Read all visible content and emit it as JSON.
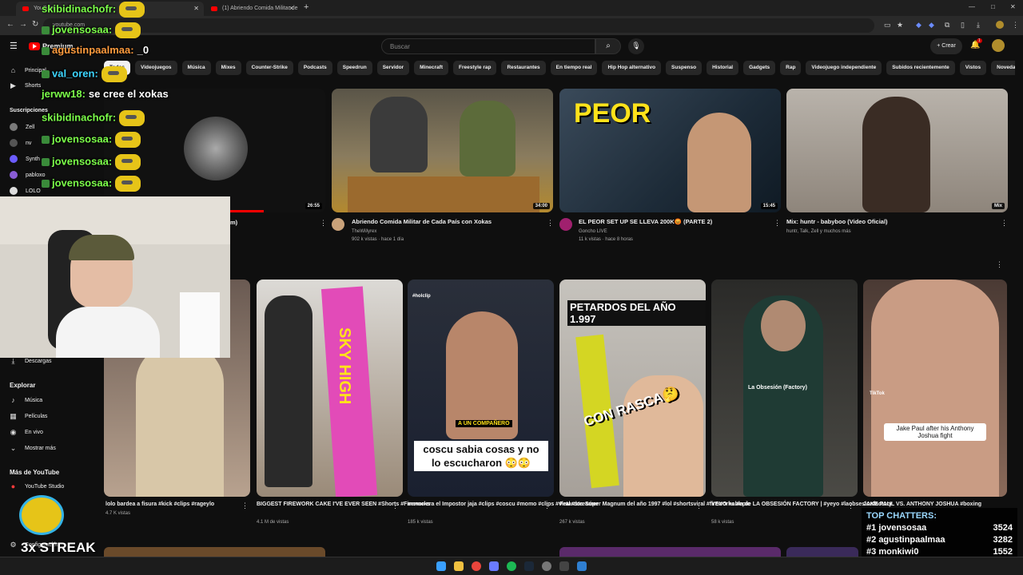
{
  "browser": {
    "tabs": [
      {
        "label": "YouTube"
      },
      {
        "label": "(1) Abriendo Comida Militar de"
      }
    ],
    "new_tab": "+",
    "url": "youtube.com",
    "window_controls": [
      "—",
      "□",
      "✕"
    ]
  },
  "header": {
    "logo": "Premium",
    "search_placeholder": "Buscar",
    "create_label": "Crear",
    "notif_count": "1"
  },
  "chips": [
    "Todos",
    "Videojuegos",
    "Música",
    "Mixes",
    "Counter-Strike",
    "Podcasts",
    "Speedrun",
    "Servidor",
    "Minecraft",
    "Freestyle rap",
    "Restaurantes",
    "En tiempo real",
    "Hip Hop alternativo",
    "Suspenso",
    "Historial",
    "Gadgets",
    "Rap",
    "Videojuego independiente",
    "Subidos recientemente",
    "Vistos",
    "Novedad pa"
  ],
  "sidebar": {
    "main": [
      {
        "label": "Principal",
        "icon": "home-icon"
      },
      {
        "label": "Shorts",
        "icon": "shorts-icon"
      }
    ],
    "subs_heading": "Suscripciones",
    "subs": [
      {
        "label": "Zell",
        "color": "#7a7a7a"
      },
      {
        "label": "nv",
        "color": "#555555"
      },
      {
        "label": "Synth",
        "color": "#6b5cff"
      },
      {
        "label": "pabloxo",
        "color": "#8a5dd6"
      },
      {
        "label": "LOLO",
        "color": "#dddddd"
      }
    ],
    "downloads": "Descargas",
    "explore_heading": "Explorar",
    "explore": [
      {
        "label": "Música",
        "icon": "music-icon"
      },
      {
        "label": "Películas",
        "icon": "film-icon"
      },
      {
        "label": "En vivo",
        "icon": "live-icon"
      },
      {
        "label": "Mostrar más",
        "icon": "chevron-down-icon"
      }
    ],
    "more_heading": "Más de YouTube",
    "more": [
      {
        "label": "YouTube Studio"
      }
    ],
    "settings": "Configuración"
  },
  "row1": [
    {
      "title": "",
      "title_suffix": "m)",
      "duration": "26:55"
    },
    {
      "title": "Abriendo Comida Militar de Cada País con Xokas",
      "channel": "TheWillyrex",
      "meta": "902 k vistas · hace 1 día",
      "duration": "34:00",
      "avatar": "#c9a27a"
    },
    {
      "title": "EL PEOR SET UP SE LLEVA 200K😡 (PARTE 2)",
      "channel": "Goncho LIVE",
      "meta": "11 k vistas · hace 8 horas",
      "duration": "15:45",
      "avatar": "#a0206e",
      "thumb_text": "PEOR"
    },
    {
      "title": "Mix: huntr - babyboo (Video Oficial)",
      "channel": "huntr, Talk, Zell y muchos más",
      "duration": "Mix"
    }
  ],
  "shorts": [
    {
      "title": "lolo bardea a fisura #kick #clips #rageylo",
      "views": "4.7 K vistas"
    },
    {
      "title": "BIGGEST FIREWORK CAKE I'VE EVER SEEN #Shorts #Fireworks",
      "views": "4.1 M de vistas",
      "thumb_text": "SKY HIGH"
    },
    {
      "title": "momo era el Impostor jaja #clips #coscu #momo #clips #viral #streamer",
      "views": "185 k vistas",
      "thumb_top": "#holclip",
      "thumb_text": "A UN COMPAÑERO",
      "caption": "coscu sabia cosas y no lo escucharon 😳😳"
    },
    {
      "title": "Petardos Súper Magnum del año 1997 #lol #shortsviral #fireworks #epic",
      "views": "267 k vistas",
      "thumb_text": "PETARDOS DEL AÑO 1.997",
      "caption": "CON RASCA🤔"
    },
    {
      "title": "YEYO habla de LA OBSESIÓN FACTORY | #yeyo #laobsesionfactory",
      "views": "58 k vistas",
      "caption": "La Obsesión (Factory)"
    },
    {
      "title": "JAKE PAUL VS. ANTHONY JOSHUA #boxing",
      "views": "",
      "caption": "Jake Paul after his Anthony Joshua fight",
      "tag": "TikTok"
    }
  ],
  "chat": [
    {
      "user": "skibidinachofr:",
      "msg": "",
      "color": "#7cff4a",
      "emote": true
    },
    {
      "user": "jovensosaa:",
      "msg": "",
      "color": "#7cff4a",
      "emote": true,
      "badge": true
    },
    {
      "user": "agustinpaalmaa:",
      "msg": "_0",
      "color": "#ff9b3d",
      "badge": true
    },
    {
      "user": "val_oren:",
      "msg": "",
      "color": "#3dd6ff",
      "emote": true,
      "badge": true
    },
    {
      "user": "jerww18:",
      "msg": "se cree el xokas",
      "color": "#7cff4a"
    },
    {
      "user": "skibidinachofr:",
      "msg": "",
      "color": "#7cff4a",
      "emote": true
    },
    {
      "user": "jovensosaa:",
      "msg": "",
      "color": "#7cff4a",
      "emote": true,
      "badge": true
    },
    {
      "user": "jovensosaa:",
      "msg": "",
      "color": "#7cff4a",
      "emote": true,
      "badge": true
    },
    {
      "user": "jovensosaa:",
      "msg": "",
      "color": "#7cff4a",
      "emote": true,
      "badge": true
    }
  ],
  "top_chatters": {
    "heading": "TOP CHATTERS:",
    "rows": [
      {
        "rank": "#1",
        "name": "jovensosaa",
        "count": "3524"
      },
      {
        "rank": "#2",
        "name": "agustinpaalmaa",
        "count": "3282"
      },
      {
        "rank": "#3",
        "name": "monkiwi0",
        "count": "1552"
      }
    ]
  },
  "streak": "3x STREAK"
}
